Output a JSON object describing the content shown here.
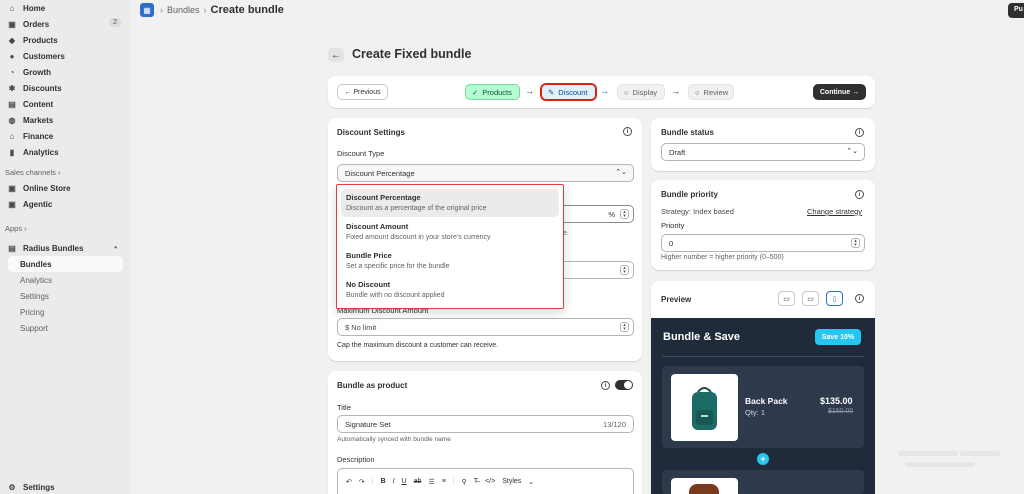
{
  "sidebar": {
    "items": [
      {
        "label": "Home",
        "icon": "home-icon",
        "glyph": "⌂"
      },
      {
        "label": "Orders",
        "icon": "inbox-icon",
        "glyph": "▣",
        "badge": "2"
      },
      {
        "label": "Products",
        "icon": "tag-icon",
        "glyph": "◆"
      },
      {
        "label": "Customers",
        "icon": "person-icon",
        "glyph": "●"
      },
      {
        "label": "Growth",
        "icon": "growth-icon",
        "glyph": "◔"
      },
      {
        "label": "Discounts",
        "icon": "discount-icon",
        "glyph": "✱"
      },
      {
        "label": "Content",
        "icon": "content-icon",
        "glyph": "▤"
      },
      {
        "label": "Markets",
        "icon": "globe-icon",
        "glyph": "◍"
      },
      {
        "label": "Finance",
        "icon": "bank-icon",
        "glyph": "⌂"
      },
      {
        "label": "Analytics",
        "icon": "chart-icon",
        "glyph": "▮"
      }
    ],
    "sales_channels_label": "Sales channels ›",
    "channels": [
      {
        "label": "Online Store",
        "icon": "store-icon",
        "glyph": "▣"
      },
      {
        "label": "Agentic",
        "icon": "agent-icon",
        "glyph": "▣"
      }
    ],
    "apps_label": "Apps ›",
    "app": {
      "label": "Radius Bundles",
      "icon": "app-icon",
      "glyph": "▤",
      "dot": "•"
    },
    "app_sub": [
      "Bundles",
      "Analytics",
      "Settings",
      "Pricing",
      "Support"
    ],
    "settings_label": "Settings"
  },
  "topbar": {
    "crumb_parent": "Bundles",
    "crumb_sep": "›",
    "crumb_current": "Create bundle",
    "publish_label": "Pu"
  },
  "page": {
    "title": "Create Fixed bundle",
    "back_glyph": "←"
  },
  "stepper": {
    "previous_label": "← Previous",
    "continue_label": "Continue →",
    "steps": [
      {
        "label": "Products",
        "glyph": "✓"
      },
      {
        "label": "Discount",
        "glyph": "✎"
      },
      {
        "label": "Display",
        "glyph": "○"
      },
      {
        "label": "Review",
        "glyph": "○"
      }
    ],
    "arrow": "→"
  },
  "discount_settings": {
    "title": "Discount Settings",
    "type_label": "Discount Type",
    "type_value": "Discount Percentage",
    "percent_suffix": "%",
    "trailing_text": "e.",
    "max_label": "Maximum Discount Amount",
    "max_placeholder": "$ No limit",
    "max_help": "Cap the maximum discount a customer can receive.",
    "options": [
      {
        "title": "Discount Percentage",
        "desc": "Discount as a percentage of the original price"
      },
      {
        "title": "Discount Amount",
        "desc": "Fixed amount discount in your store's currency"
      },
      {
        "title": "Bundle Price",
        "desc": "Set a specific price for the bundle"
      },
      {
        "title": "No Discount",
        "desc": "Bundle with no discount applied"
      }
    ]
  },
  "bundle_product": {
    "title": "Bundle as product",
    "title_label": "Title",
    "title_value": "Signature Set",
    "title_count": "13/120",
    "title_help": "Automatically synced with bundle name",
    "description_label": "Description",
    "toolbar_styles": "Styles"
  },
  "bundle_status": {
    "title": "Bundle status",
    "value": "Draft"
  },
  "bundle_priority": {
    "title": "Bundle priority",
    "strategy": "Strategy: Index based",
    "change_link": "Change strategy",
    "priority_label": "Priority",
    "priority_value": "0",
    "help": "Higher number = higher priority (0–500)"
  },
  "preview": {
    "title": "Preview",
    "widget_title": "Bundle & Save",
    "badge": "Save 10%",
    "item_name": "Back Pack",
    "item_qty": "Qty: 1",
    "item_price": "$135.00",
    "item_old_price": "$150.00",
    "plus": "+",
    "accent": "#26c6f0",
    "bg": "#1f2a3a"
  }
}
